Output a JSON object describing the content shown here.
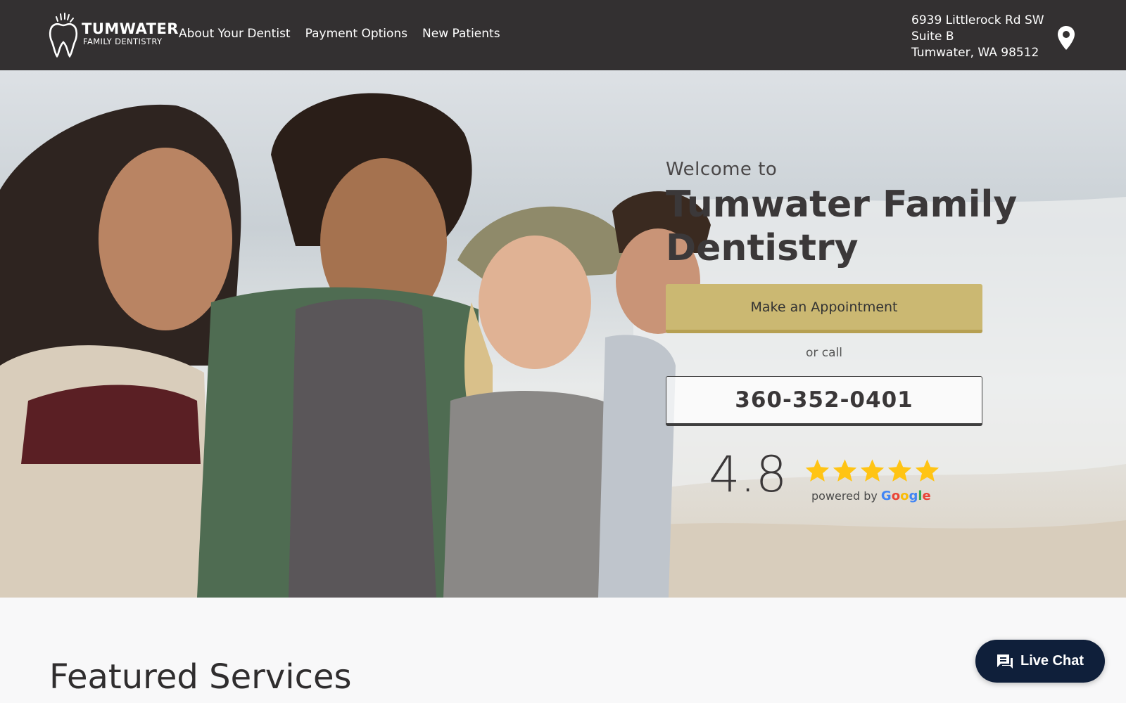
{
  "header": {
    "logo": {
      "line1": "TUMWATER",
      "line2": "FAMILY DENTISTRY"
    },
    "nav": [
      {
        "label": "About Your Dentist"
      },
      {
        "label": "Payment Options"
      },
      {
        "label": "New Patients"
      }
    ],
    "address": {
      "line1": "6939 Littlerock Rd SW",
      "line2": "Suite B",
      "line3": "Tumwater, WA 98512"
    },
    "pin_icon": "map-pin-icon"
  },
  "hero": {
    "welcome": "Welcome to",
    "title": "Tumwater Family Dentistry",
    "appointment_button": "Make an Appointment",
    "or_call": "or call",
    "phone": "360-352-0401",
    "rating": {
      "value": "4.8",
      "stars": 5,
      "star_color": "#FFC414",
      "powered_by": "powered by",
      "provider": "Google"
    }
  },
  "featured": {
    "title": "Featured Services"
  },
  "chat": {
    "label": "Live Chat",
    "icon": "chat-bubble-icon"
  },
  "colors": {
    "header_bg": "#333031",
    "accent_gold": "#CBB872",
    "chat_bg": "#0F1F3A"
  }
}
